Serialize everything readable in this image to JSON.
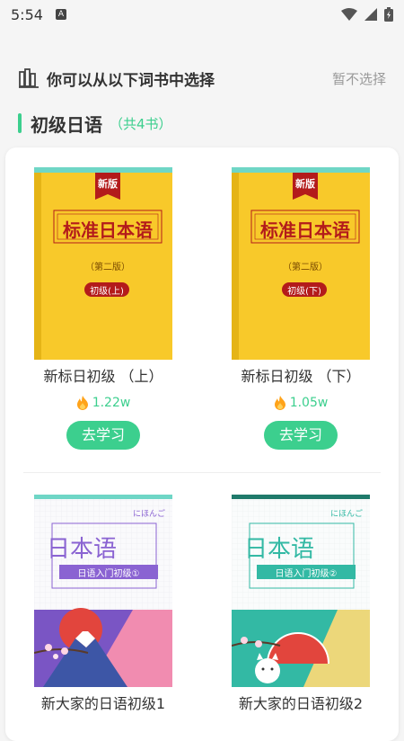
{
  "status_bar": {
    "time": "5:54",
    "notification_icon": "A"
  },
  "header": {
    "title": "你可以从以下词书中选择",
    "skip_label": "暂不选择"
  },
  "section": {
    "title": "初级日语",
    "count": "（共4书）"
  },
  "books": [
    {
      "title": "新标日初级 （上）",
      "heat": "1.22w",
      "button": "去学习",
      "cover": {
        "ribbon": "新版",
        "main": "标准日本语",
        "edition": "（第二版）",
        "level": "初级(上)"
      }
    },
    {
      "title": "新标日初级 （下）",
      "heat": "1.05w",
      "button": "去学习",
      "cover": {
        "ribbon": "新版",
        "main": "标准日本语",
        "edition": "（第二版）",
        "level": "初级(下)"
      }
    },
    {
      "title": "新大家的日语初级1",
      "cover": {
        "kana": "にほんご",
        "main": "日本语",
        "sub": "日语入门初级①"
      }
    },
    {
      "title": "新大家的日语初级2",
      "cover": {
        "kana": "にほんご",
        "main": "日本语",
        "sub": "日语入门初级②"
      }
    }
  ],
  "colors": {
    "accent": "#3ccf8e",
    "cover_yellow": "#f8c92a",
    "ribbon_red": "#b31b1b",
    "purple": "#8a63d2",
    "teal": "#33b9a4"
  }
}
